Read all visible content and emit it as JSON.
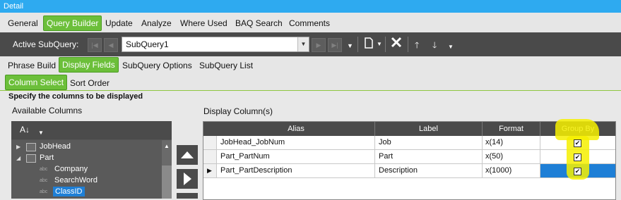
{
  "window": {
    "title": "Detail"
  },
  "main_tabs": [
    {
      "label": "General",
      "active": false
    },
    {
      "label": "Query Builder",
      "active": true
    },
    {
      "label": "Update",
      "active": false
    },
    {
      "label": "Analyze",
      "active": false
    },
    {
      "label": "Where Used",
      "active": false
    },
    {
      "label": "BAQ Search",
      "active": false
    },
    {
      "label": "Comments",
      "active": false
    }
  ],
  "toolbar": {
    "active_subquery_label": "Active SubQuery:",
    "subquery_value": "SubQuery1",
    "icons": [
      "first-icon",
      "prev-icon",
      "next-icon",
      "last-icon",
      "new-icon",
      "delete-icon",
      "move-up-icon",
      "move-down-icon"
    ]
  },
  "sub_tabs": [
    {
      "label": "Phrase Build",
      "active": false
    },
    {
      "label": "Display Fields",
      "active": true
    },
    {
      "label": "SubQuery Options",
      "active": false
    },
    {
      "label": "SubQuery List",
      "active": false
    }
  ],
  "inner_tabs": [
    {
      "label": "Column Select",
      "active": true
    },
    {
      "label": "Sort Order",
      "active": false
    }
  ],
  "instruction": "Specify the columns to be displayed",
  "available_columns": {
    "label": "Available Columns",
    "tree": [
      {
        "label": "JobHead",
        "kind": "table",
        "expanded": false
      },
      {
        "label": "Part",
        "kind": "table",
        "expanded": true
      },
      {
        "label": "Company",
        "kind": "field"
      },
      {
        "label": "SearchWord",
        "kind": "field"
      },
      {
        "label": "ClassID",
        "kind": "field",
        "selected": true
      }
    ]
  },
  "display_columns": {
    "label": "Display Column(s)",
    "headers": [
      "Alias",
      "Label",
      "Format",
      "Group By"
    ],
    "rows": [
      {
        "alias": "JobHead_JobNum",
        "label": "Job",
        "format": "x(14)",
        "group_by": true,
        "current": false
      },
      {
        "alias": "Part_PartNum",
        "label": "Part",
        "format": "x(50)",
        "group_by": true,
        "current": false
      },
      {
        "alias": "Part_PartDescription",
        "label": "Description",
        "format": "x(1000)",
        "group_by": true,
        "current": true
      }
    ]
  },
  "colors": {
    "accent_green": "#6cbf3a",
    "title_blue": "#2eaaf0",
    "dark_toolbar": "#4a4a4a",
    "selection_blue": "#1e7fd6",
    "highlight_yellow": "#f6f000"
  }
}
